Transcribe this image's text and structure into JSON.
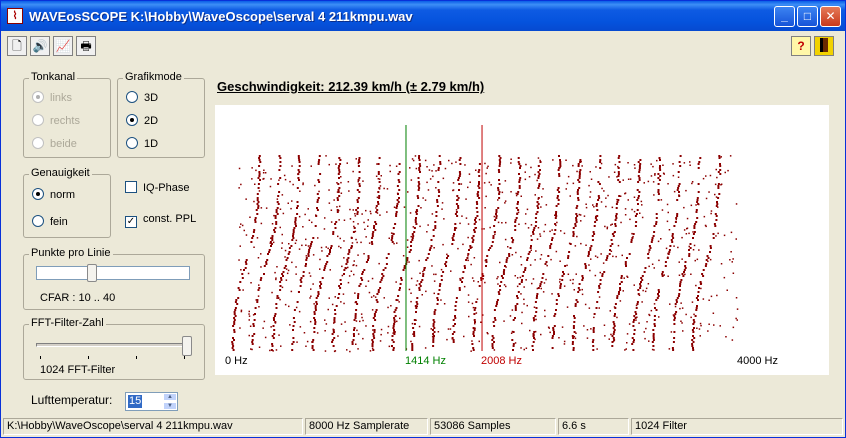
{
  "window": {
    "title": "WAVEosSCOPE  K:\\Hobby\\WaveOscope\\serval 4 211kmpu.wav",
    "app_icon": "waveform-icon",
    "minimize_glyph": "_",
    "maximize_glyph": "□",
    "close_glyph": "✕"
  },
  "toolbar": {
    "tools": [
      {
        "name": "new-file-icon",
        "glyph": "🗋"
      },
      {
        "name": "speaker-icon",
        "glyph": "🔊"
      },
      {
        "name": "spectrum-icon",
        "glyph": "📈"
      },
      {
        "name": "printer-icon",
        "glyph": "🖶"
      }
    ],
    "help_glyph": "?",
    "exit_icon": "exit-door-icon"
  },
  "tonkanal": {
    "label": "Tonkanal",
    "options": [
      "links",
      "rechts",
      "beide"
    ],
    "selected": "links",
    "disabled": true
  },
  "grafikmode": {
    "label": "Grafikmode",
    "options": [
      "3D",
      "2D",
      "1D"
    ],
    "selected": "2D"
  },
  "genauigkeit": {
    "label": "Genauigkeit",
    "options": [
      "norm",
      "fein"
    ],
    "selected": "norm"
  },
  "checks": {
    "iq_phase": {
      "label": "IQ-Phase",
      "checked": false
    },
    "const_ppl": {
      "label": "const. PPL",
      "checked": true
    }
  },
  "punkte": {
    "label": "Punkte pro Linie",
    "value_text": "CFAR : 10 .. 40",
    "position": 0.3
  },
  "fft": {
    "label": "FFT-Filter-Zahl",
    "value_text": "1024 FFT-Filter",
    "position": 1.0
  },
  "lufttemp": {
    "label": "Lufttemperatur:",
    "value": "15"
  },
  "speed_text": "Geschwindigkeit: 212.39 km/h (± 2.79 km/h)",
  "plot": {
    "axis": {
      "min_label": "0 Hz",
      "max_label": "4000 Hz",
      "max_hz": 4000
    },
    "marker_green": {
      "hz": 1414,
      "label": "1414 Hz",
      "color": "#008000"
    },
    "marker_red": {
      "hz": 2008,
      "label": "2008 Hz",
      "color": "#c00000"
    },
    "dot_color": "#8b0000"
  },
  "status": {
    "file": "K:\\Hobby\\WaveOscope\\serval 4 211kmpu.wav",
    "samplerate": "8000 Hz Samplerate",
    "samples": "53086 Samples",
    "duration": "6.6 s",
    "filters": "1024 Filter"
  }
}
